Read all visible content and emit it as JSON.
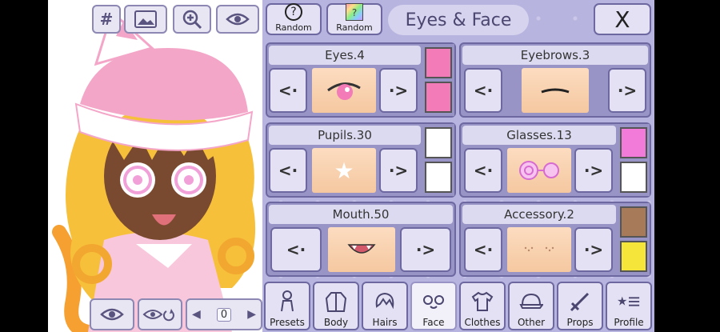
{
  "toolbar": {
    "hash_label": "#"
  },
  "header": {
    "random_1_label": "Random",
    "random_1_icon": "?",
    "random_2_label": "Random",
    "random_2_icon": "?",
    "title": "Eyes & Face",
    "close_label": "X"
  },
  "cards": [
    {
      "title": "Eyes.4",
      "prev": "<·",
      "next": "·>",
      "swatches": [
        "#f27bb8",
        "#f27bb8"
      ]
    },
    {
      "title": "Eyebrows.3",
      "prev": "<·",
      "next": "·>",
      "swatches": []
    },
    {
      "title": "Pupils.30",
      "prev": "<·",
      "next": "·>",
      "swatches": [
        "#ffffff",
        "#ffffff"
      ]
    },
    {
      "title": "Glasses.13",
      "prev": "<·",
      "next": "·>",
      "swatches": [
        "#f27bd9",
        "#ffffff"
      ]
    },
    {
      "title": "Mouth.50",
      "prev": "<·",
      "next": "·>",
      "swatches": []
    },
    {
      "title": "Accessory.2",
      "prev": "<·",
      "next": "·>",
      "swatches": [
        "#a77b5a",
        "#f5e53a"
      ]
    }
  ],
  "tabs": [
    {
      "label": "Presets",
      "icon": "person-icon",
      "active": false
    },
    {
      "label": "Body",
      "icon": "jacket-icon",
      "active": false
    },
    {
      "label": "Hairs",
      "icon": "hair-icon",
      "active": false
    },
    {
      "label": "Face",
      "icon": "face-icon",
      "active": true
    },
    {
      "label": "Clothes",
      "icon": "shirt-icon",
      "active": false
    },
    {
      "label": "Other",
      "icon": "cap-icon",
      "active": false
    },
    {
      "label": "Props",
      "icon": "sword-icon",
      "active": false
    },
    {
      "label": "Profile",
      "icon": "profile-icon",
      "active": false
    }
  ],
  "layer": {
    "value": "0"
  }
}
